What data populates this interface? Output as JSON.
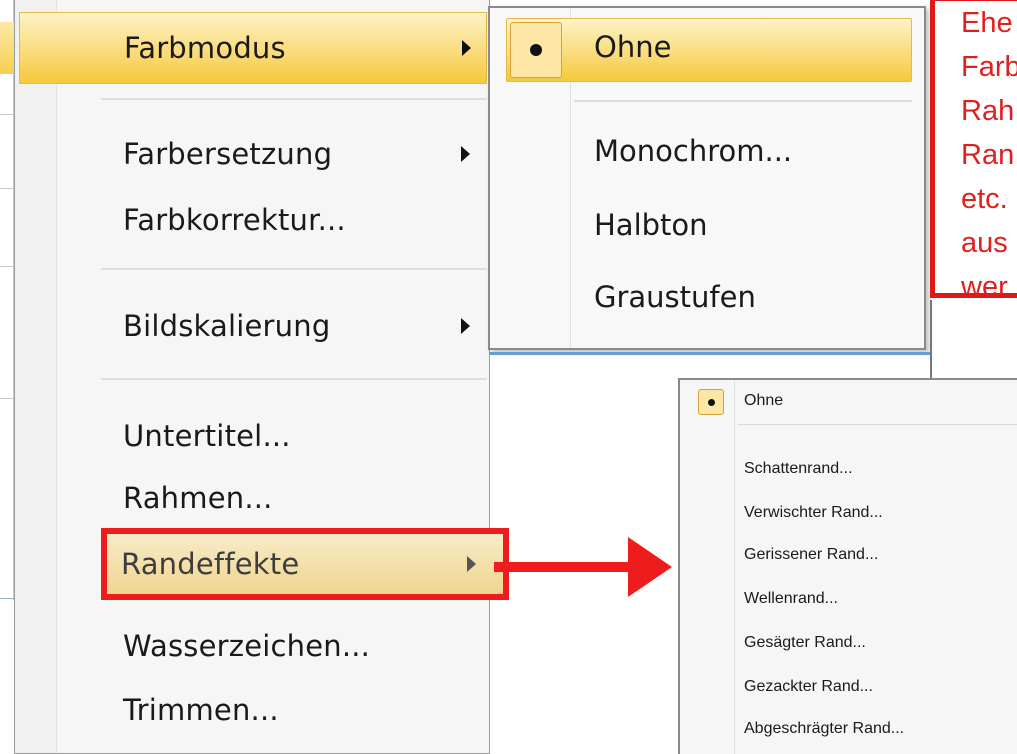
{
  "main_menu": {
    "items": [
      {
        "label": "Farbmodus"
      },
      {
        "label": "Farbersetzung"
      },
      {
        "label": "Farbkorrektur..."
      },
      {
        "label": "Bildskalierung"
      },
      {
        "label": "Untertitel..."
      },
      {
        "label": "Rahmen..."
      },
      {
        "label": "Randeffekte"
      },
      {
        "label": "Wasserzeichen..."
      },
      {
        "label": "Trimmen..."
      }
    ]
  },
  "farbmodus_submenu": {
    "items": [
      {
        "label": "Ohne",
        "selected": true
      },
      {
        "label": "Monochrom..."
      },
      {
        "label": "Halbton"
      },
      {
        "label": "Graustufen"
      }
    ]
  },
  "randeffekte_submenu": {
    "items": [
      {
        "label": "Ohne",
        "selected": true
      },
      {
        "label": "Schattenrand..."
      },
      {
        "label": "Verwischter Rand..."
      },
      {
        "label": "Gerissener Rand..."
      },
      {
        "label": "Wellenrand..."
      },
      {
        "label": "Gesägter Rand..."
      },
      {
        "label": "Gezackter Rand..."
      },
      {
        "label": "Abgeschrägter Rand..."
      }
    ]
  },
  "annotation": {
    "lines": [
      "Ehe",
      "Farb",
      "Rah",
      "Ran",
      "etc.",
      "aus",
      "wer"
    ],
    "color": "#e02020"
  },
  "colors": {
    "highlight": "#f5c93a",
    "annotation_red": "#ee1c1c"
  }
}
